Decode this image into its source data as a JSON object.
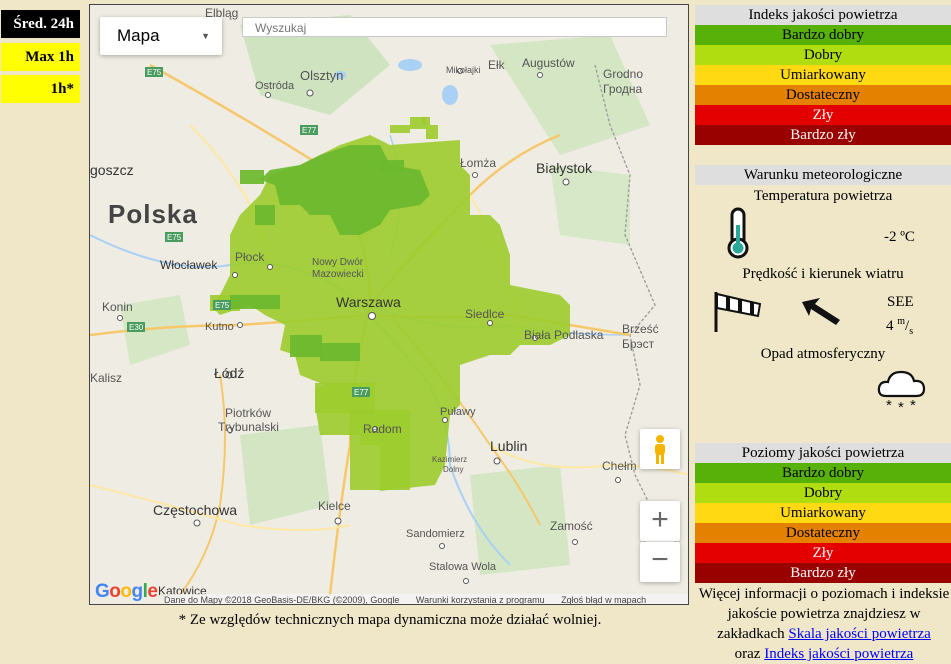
{
  "periods": [
    "Śred. 24h",
    "Max 1h",
    "1h*"
  ],
  "map": {
    "type_label": "Mapa",
    "search_placeholder": "Wyszukaj",
    "country_label": "Polska",
    "cities": {
      "elblag": "Elbląg",
      "olsztyn": "Olsztyn",
      "ostroda": "Ostróda",
      "mikolajki": "Mikołajki",
      "elk": "Ełk",
      "augustow": "Augustów",
      "grodno": "Grodno",
      "grodno2": "Гродна",
      "lomza": "Łomża",
      "bialystok": "Białystok",
      "goszcz": "goszcz",
      "wloclawek": "Włocławek",
      "plock": "Płock",
      "nowydwor": "Nowy Dwór",
      "nowydwor2": "Mazowiecki",
      "warszawa": "Warszawa",
      "siedlce": "Siedlce",
      "biala": "Biała Podlaska",
      "brzesc": "Brześć",
      "brzesc2": "Брэст",
      "konin": "Konin",
      "kutno": "Kutno",
      "kalisz": "Kalisz",
      "lodz": "Łódź",
      "piotrkow": "Piotrków",
      "piotrkow2": "Trybunalski",
      "radom": "Radom",
      "pulawy": "Puławy",
      "kazimierz": "Kazimierz",
      "kazimierz2": "Dolny",
      "lublin": "Lublin",
      "chelm": "Chełm",
      "czestochowa": "Częstochowa",
      "kielce": "Kielce",
      "sandomierz": "Sandomierz",
      "zamosc": "Zamość",
      "stalowa": "Stalowa Wola",
      "katowice": "Katowice"
    },
    "roads": [
      "E75",
      "E77",
      "E75",
      "E75",
      "E30",
      "E77"
    ],
    "attribution": [
      "Dane do Mapy ©2018 GeoBasis-DE/BKG (©2009), Google",
      "Warunki korzystania z programu",
      "Zgłoś błąd w mapach"
    ],
    "google": [
      "G",
      "o",
      "o",
      "g",
      "l",
      "e"
    ],
    "zoom_in": "+",
    "zoom_out": "−"
  },
  "note": "* Ze względów technicznych mapa dynamiczna może działać wolniej.",
  "index_panel": {
    "title": "Indeks jakości powietrza",
    "levels": [
      "Bardzo dobry",
      "Dobry",
      "Umiarkowany",
      "Dostateczny",
      "Zły",
      "Bardzo zły"
    ]
  },
  "meteo": {
    "title": "Warunku meteorologiczne",
    "temp_label": "Temperatura powietrza",
    "temp_value": "-2 ºC",
    "wind_label": "Prędkość i kierunek wiatru",
    "wind_dir": "SEE",
    "wind_speed": "4",
    "wind_unit_num": "m",
    "wind_unit_den": "s",
    "precip_label": "Opad atmosferyczny"
  },
  "levels_panel": {
    "title": "Poziomy jakości powietrza",
    "levels": [
      "Bardzo dobry",
      "Dobry",
      "Umiarkowany",
      "Dostateczny",
      "Zły",
      "Bardzo zły"
    ]
  },
  "info": {
    "text1": "Więcej informacji o poziomach i indeksie jakoście powietrza znajdziesz w zakładkach",
    "link1": "Skala jakości powietrza",
    "text2": "oraz",
    "link2": "Indeks jakości powietrza"
  },
  "colors": {
    "level_colors": [
      "#57b108",
      "#b0dd10",
      "#ffd911",
      "#e58100",
      "#e50000",
      "#990000"
    ],
    "map_fill_good": "#9ccc2c",
    "map_fill_verygood": "#6bb82e",
    "period_active": "#000000",
    "period_inactive": "#ffff00"
  }
}
